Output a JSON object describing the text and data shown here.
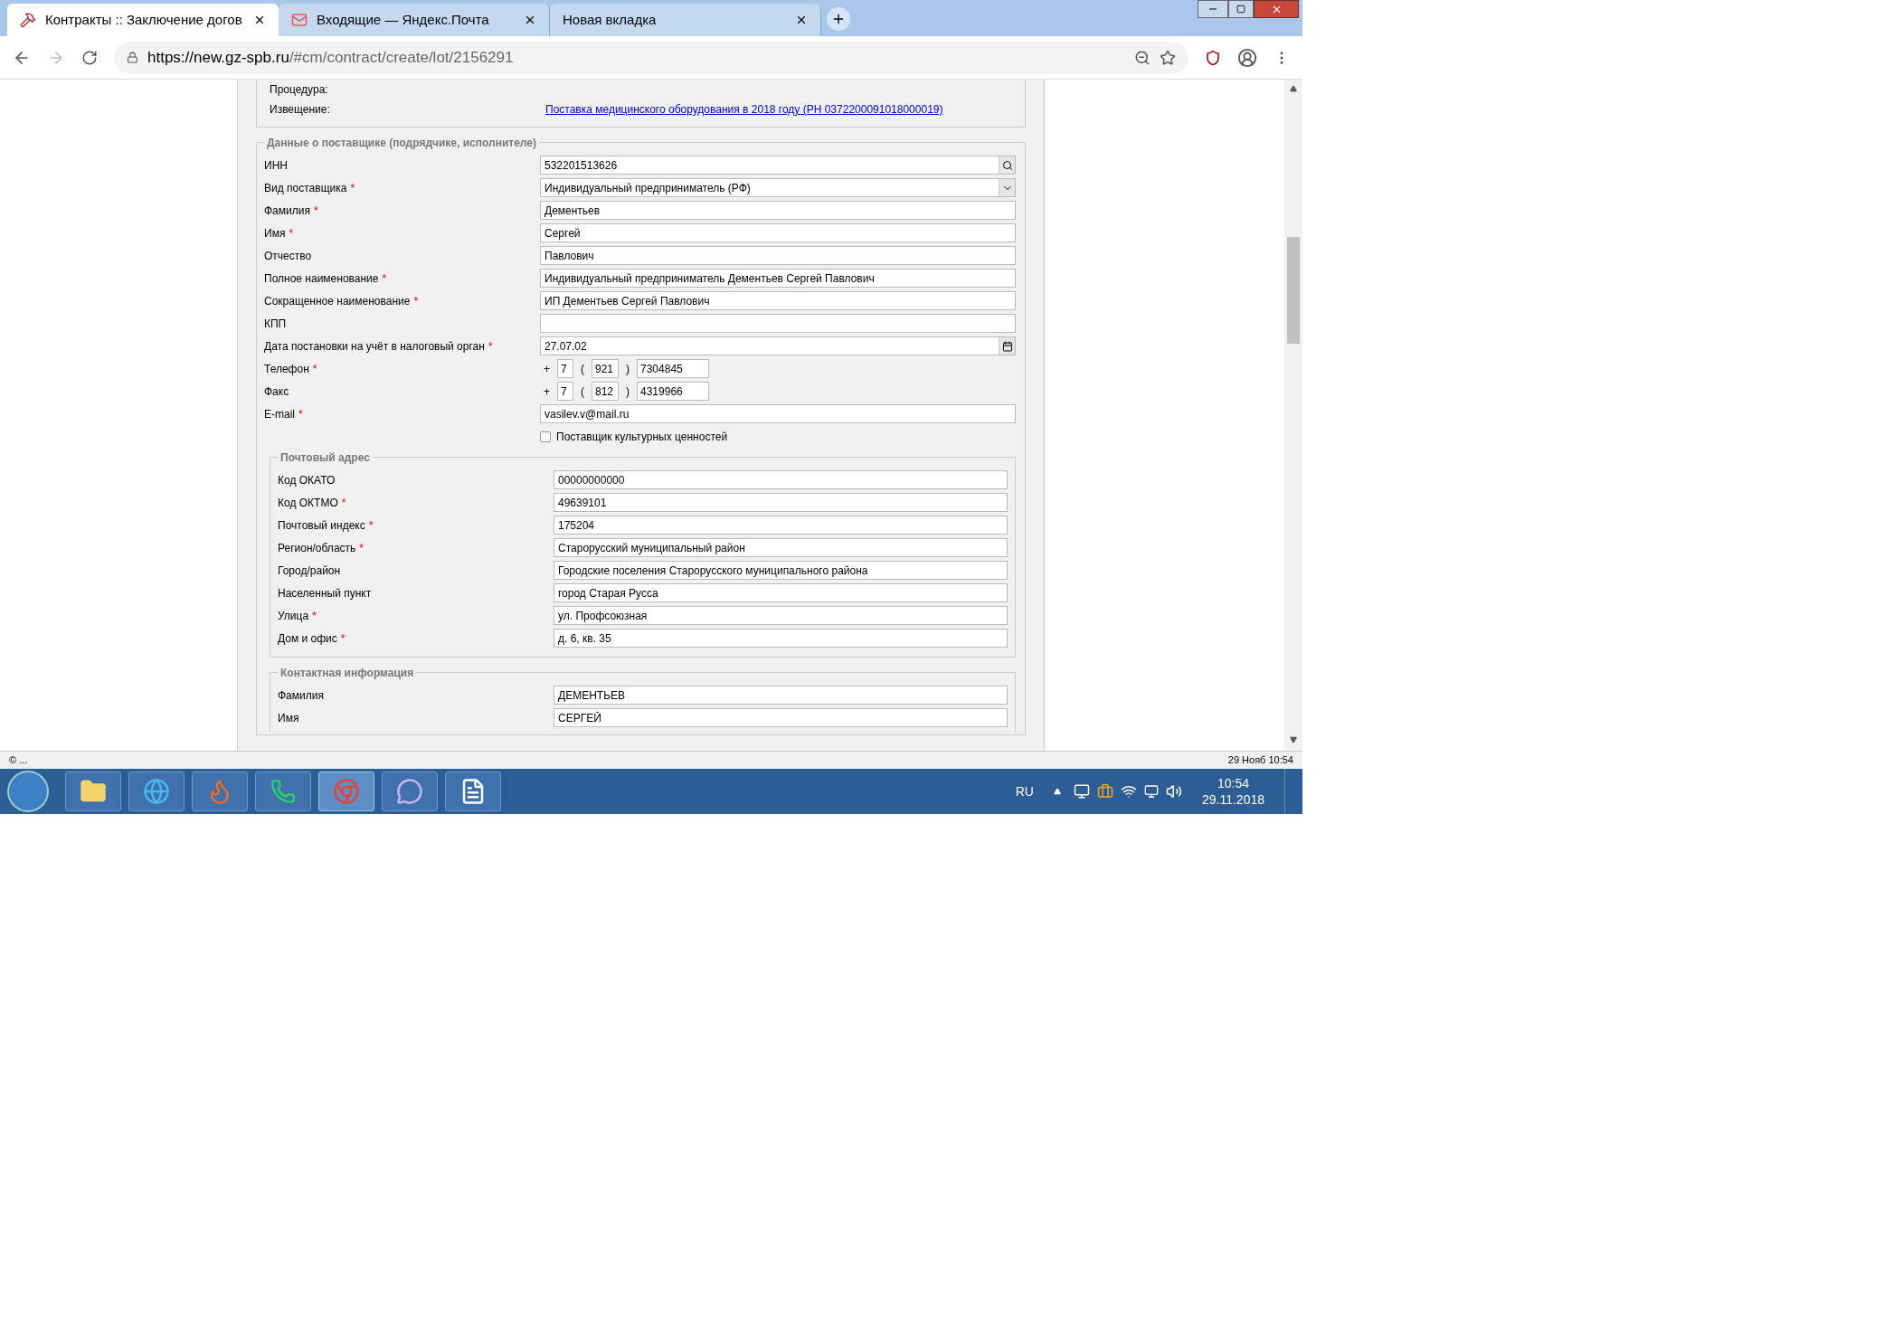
{
  "browser": {
    "tabs": [
      {
        "title": "Контракты :: Заключение догов",
        "selected": true
      },
      {
        "title": "Входящие — Яндекс.Почта",
        "selected": false
      },
      {
        "title": "Новая вкладка",
        "selected": false
      }
    ],
    "url_host": "https://new.gz-spb.ru",
    "url_path": "/#cm/contract/create/lot/2156291"
  },
  "required_mark": "*",
  "top_panel": {
    "rows": [
      {
        "label": "Процедура:"
      },
      {
        "label": "Извещение:",
        "link": "Поставка медицинского оборудования в 2018 году (РН 0372200091018000019)"
      }
    ]
  },
  "supplier": {
    "legend": "Данные о поставщике (подрядчике, исполнителе)",
    "fields": [
      {
        "kind": "search",
        "label": "ИНН",
        "required": false,
        "value": "532201513626"
      },
      {
        "kind": "select",
        "label": "Вид поставщика",
        "required": true,
        "value": "Индивидуальный предприниматель (РФ)"
      },
      {
        "kind": "text",
        "label": "Фамилия",
        "required": true,
        "value": "Дементьев"
      },
      {
        "kind": "text",
        "label": "Имя",
        "required": true,
        "value": "Сергей"
      },
      {
        "kind": "text",
        "label": "Отчество",
        "required": false,
        "value": "Павлович"
      },
      {
        "kind": "text",
        "label": "Полное наименование",
        "required": true,
        "value": "Индивидуальный предприниматель Дементьев Сергей Павлович"
      },
      {
        "kind": "text",
        "label": "Сокращенное наименование",
        "required": true,
        "value": "ИП Дементьев Сергей Павлович"
      },
      {
        "kind": "text",
        "label": "КПП",
        "required": false
      },
      {
        "kind": "date",
        "label": "Дата постановки на учёт в налоговый орган",
        "required": true,
        "value": "27.07.02"
      },
      {
        "kind": "phone",
        "label": "Телефон",
        "required": true,
        "prefix": "+",
        "country": "7",
        "open": "(",
        "code": "921",
        "close": ")",
        "number": "7304845"
      },
      {
        "kind": "phone",
        "label": "Факс",
        "required": false,
        "prefix": "+",
        "country": "7",
        "open": "(",
        "code": "812",
        "close": ")",
        "number": "4319966"
      },
      {
        "kind": "text",
        "label": "E-mail",
        "required": true,
        "value": "vasilev.v@mail.ru"
      },
      {
        "kind": "checkbox",
        "label": "Поставщик культурных ценностей",
        "checked": false
      }
    ]
  },
  "postal": {
    "legend": "Почтовый адрес",
    "fields": [
      {
        "kind": "text",
        "label": "Код ОКАТО",
        "required": false,
        "value": "00000000000"
      },
      {
        "kind": "text",
        "label": "Код ОКТМО",
        "required": true,
        "value": "49639101"
      },
      {
        "kind": "text",
        "label": "Почтовый индекс",
        "required": true,
        "value": "175204"
      },
      {
        "kind": "text",
        "label": "Регион/область",
        "required": true,
        "value": "Старорусский муниципальный район"
      },
      {
        "kind": "text",
        "label": "Город/район",
        "required": false,
        "value": "Городские поселения Старорусского муниципального района"
      },
      {
        "kind": "text",
        "label": "Населенный пункт",
        "required": false,
        "value": "город Старая Русса"
      },
      {
        "kind": "text",
        "label": "Улица",
        "required": true,
        "value": "ул. Профсоюзная"
      },
      {
        "kind": "text",
        "label": "Дом и офис",
        "required": true,
        "value": "д. 6, кв. 35"
      }
    ]
  },
  "contact": {
    "legend": "Контактная информация",
    "fields": [
      {
        "kind": "text",
        "label": "Фамилия",
        "required": false,
        "value": "ДЕМЕНТЬЕВ"
      },
      {
        "kind": "text",
        "label": "Имя",
        "required": false,
        "value": "СЕРГЕЙ"
      }
    ]
  },
  "status_bar": {
    "left": "© ...",
    "right": "29 Нояб 10:54"
  },
  "taskbar": {
    "language": "RU",
    "time": "10:54",
    "date": "29.11.2018"
  }
}
